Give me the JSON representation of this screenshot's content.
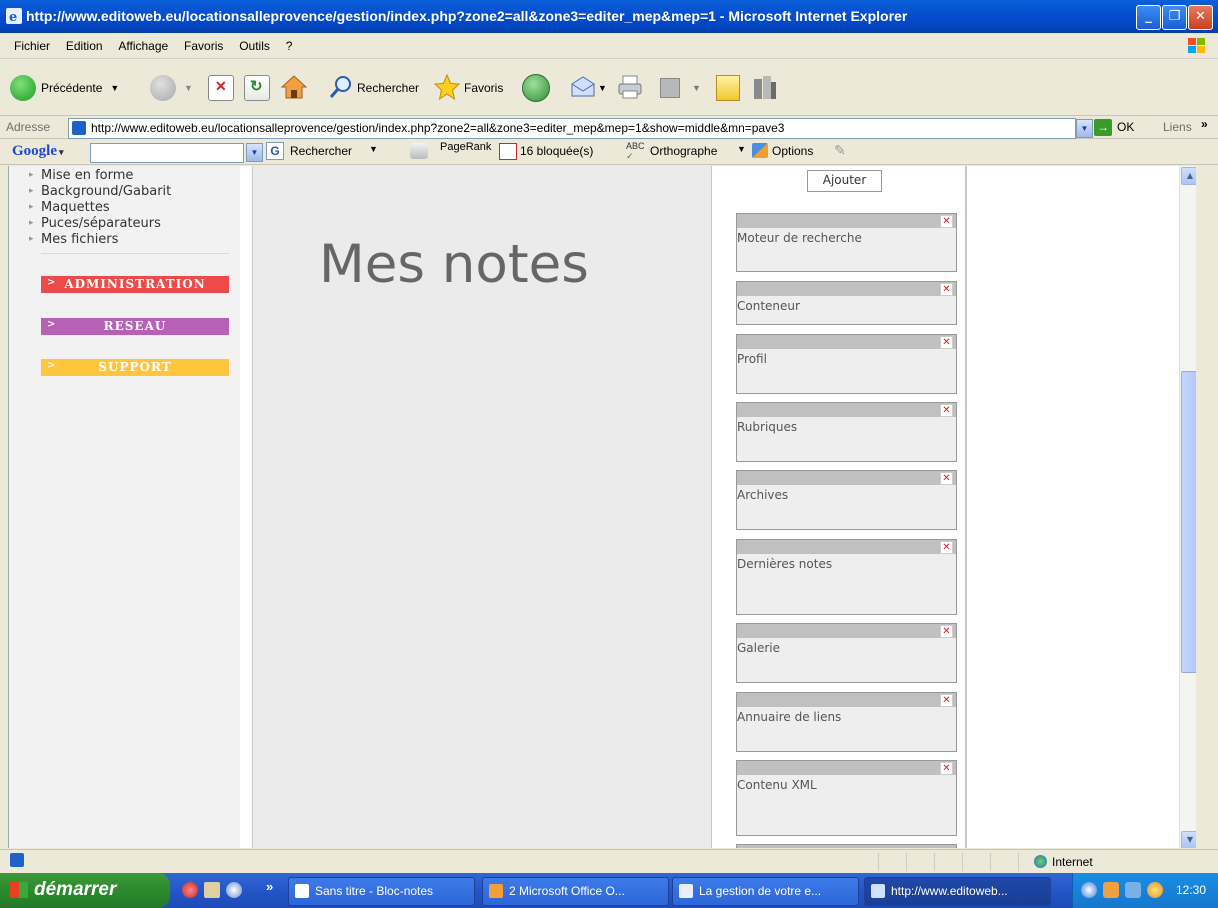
{
  "window": {
    "title": "http://www.editoweb.eu/locationsalleprovence/gestion/index.php?zone2=all&zone3=editer_mep&mep=1 - Microsoft Internet Explorer"
  },
  "menu": [
    "Fichier",
    "Edition",
    "Affichage",
    "Favoris",
    "Outils",
    "?"
  ],
  "toolbar": {
    "back": "Précédente",
    "search": "Rechercher",
    "favorites": "Favoris"
  },
  "address": {
    "label": "Adresse",
    "url": "http://www.editoweb.eu/locationsalleprovence/gestion/index.php?zone2=all&zone3=editer_mep&mep=1&show=middle&mn=pave3",
    "go": "OK",
    "links": "Liens"
  },
  "google": {
    "logo": "Google",
    "search": "Rechercher",
    "pagerank": "PageRank",
    "blocked": "16 bloquée(s)",
    "spell": "Orthographe",
    "options": "Options"
  },
  "nav": {
    "links": [
      "Mise en forme",
      "Background/Gabarit",
      "Maquettes",
      "Puces/séparateurs",
      "Mes fichiers"
    ],
    "sections": [
      {
        "label": "ADMINISTRATION",
        "color": "#ee4a4a"
      },
      {
        "label": "RESEAU",
        "color": "#b660b6"
      },
      {
        "label": "SUPPORT",
        "color": "#ffc53d"
      }
    ]
  },
  "main": {
    "heading": "Mes notes"
  },
  "widgets": {
    "add_label": "Ajouter",
    "items": [
      "Moteur de recherche",
      "Conteneur",
      "Profil",
      "Rubriques",
      "Archives",
      "Dernières notes",
      "Galerie",
      "Annuaire de liens",
      "Contenu XML"
    ]
  },
  "status": {
    "zone": "Internet"
  },
  "taskbar": {
    "start": "démarrer",
    "tasks": [
      "Sans titre - Bloc-notes",
      "2 Microsoft Office O...",
      "La gestion de votre e...",
      "http://www.editoweb..."
    ],
    "time": "12:30"
  }
}
